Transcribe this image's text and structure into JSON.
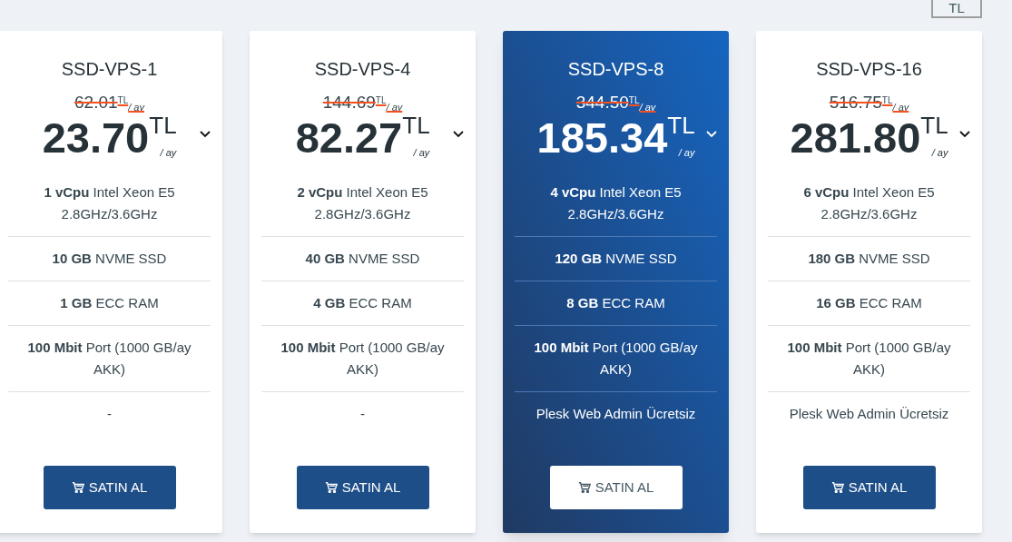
{
  "currency_button": {
    "label": "TL"
  },
  "plans": [
    {
      "name": "SSD-VPS-1",
      "featured": false,
      "old_price": "62.01$^{TL}$$_{/ ay}$",
      "price": "23.70",
      "currency": "TL",
      "period": "/ ay",
      "features": [
        "**1 vCpu** Intel Xeon E5 2.8GHz/3.6GHz",
        "**10 GB** NVME SSD",
        "**1 GB** ECC RAM",
        "**100 Mbit** Port (1000 GB/ay AKK)",
        "-"
      ],
      "button": "SATIN AL"
    },
    {
      "name": "SSD-VPS-4",
      "featured": false,
      "old_price": "144.69$^{TL}$$_{/ ay}$",
      "price": "82.27",
      "currency": "TL",
      "period": "/ ay",
      "features": [
        "**2 vCpu** Intel Xeon E5 2.8GHz/3.6GHz",
        "**40 GB** NVME SSD",
        "**4 GB** ECC RAM",
        "**100 Mbit** Port (1000 GB/ay AKK)",
        "-"
      ],
      "button": "SATIN AL"
    },
    {
      "name": "SSD-VPS-8",
      "featured": true,
      "old_price": "344.50$^{TL}$$_{/ ay}$",
      "price": "185.34",
      "currency": "TL",
      "period": "/ ay",
      "features": [
        "**4 vCpu** Intel Xeon E5 2.8GHz/3.6GHz",
        "**120 GB** NVME SSD",
        "**8 GB** ECC RAM",
        "**100 Mbit** Port (1000 GB/ay AKK)",
        "Plesk Web Admin Ücretsiz"
      ],
      "button": "SATIN AL"
    },
    {
      "name": "SSD-VPS-16",
      "featured": false,
      "old_price": "516.75$^{TL}$$_{/ ay}$",
      "price": "281.80",
      "currency": "TL",
      "period": "/ ay",
      "features": [
        "**6 vCpu** Intel Xeon E5 2.8GHz/3.6GHz",
        "**180 GB** NVME SSD",
        "**16 GB** ECC RAM",
        "**100 Mbit** Port (1000 GB/ay AKK)",
        "Plesk Web Admin Ücretsiz"
      ],
      "button": "SATIN AL"
    }
  ]
}
